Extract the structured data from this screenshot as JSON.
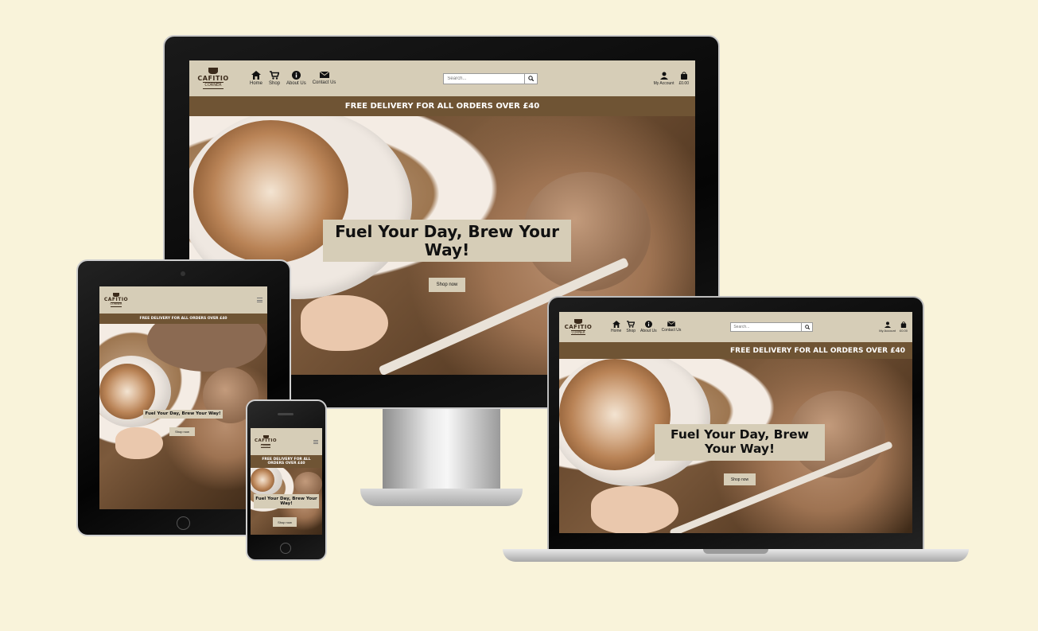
{
  "site": {
    "logo": {
      "line1": "CAFITIO",
      "line2": "CORNER"
    },
    "nav": [
      {
        "label": "Home",
        "icon": "home-icon"
      },
      {
        "label": "Shop",
        "icon": "cart-icon"
      },
      {
        "label": "About Us",
        "icon": "info-icon"
      },
      {
        "label": "Contact Us",
        "icon": "envelope-icon"
      }
    ],
    "search_placeholder": "Search...",
    "account_label": "My Account",
    "basket_label": "£0.00",
    "banner_desktop": "FREE DELIVERY FOR ALL ORDERS OVER £40",
    "hero_title": "Fuel Your Day, Brew Your Way!",
    "shop_button": "Shop now"
  },
  "colors": {
    "background": "#f9f3da",
    "header": "#d6cdb7",
    "banner": "#6f5434"
  }
}
